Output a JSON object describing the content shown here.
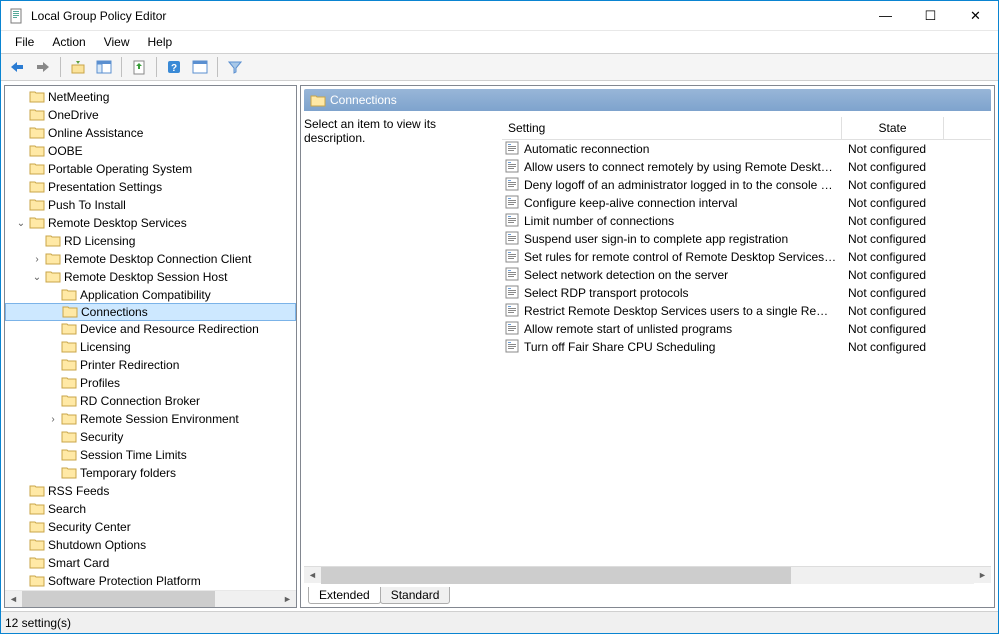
{
  "window": {
    "title": "Local Group Policy Editor",
    "minimize": "—",
    "maximize": "☐",
    "close": "✕"
  },
  "menu": {
    "file": "File",
    "action": "Action",
    "view": "View",
    "help": "Help"
  },
  "tree": [
    {
      "label": "NetMeeting",
      "indent": 3,
      "exp": ""
    },
    {
      "label": "OneDrive",
      "indent": 3,
      "exp": ""
    },
    {
      "label": "Online Assistance",
      "indent": 3,
      "exp": ""
    },
    {
      "label": "OOBE",
      "indent": 3,
      "exp": ""
    },
    {
      "label": "Portable Operating System",
      "indent": 3,
      "exp": ""
    },
    {
      "label": "Presentation Settings",
      "indent": 3,
      "exp": ""
    },
    {
      "label": "Push To Install",
      "indent": 3,
      "exp": ""
    },
    {
      "label": "Remote Desktop Services",
      "indent": 3,
      "exp": "v"
    },
    {
      "label": "RD Licensing",
      "indent": 4,
      "exp": ""
    },
    {
      "label": "Remote Desktop Connection Client",
      "indent": 4,
      "exp": ">"
    },
    {
      "label": "Remote Desktop Session Host",
      "indent": 4,
      "exp": "v"
    },
    {
      "label": "Application Compatibility",
      "indent": 5,
      "exp": ""
    },
    {
      "label": "Connections",
      "indent": 5,
      "exp": "",
      "selected": true
    },
    {
      "label": "Device and Resource Redirection",
      "indent": 5,
      "exp": ""
    },
    {
      "label": "Licensing",
      "indent": 5,
      "exp": ""
    },
    {
      "label": "Printer Redirection",
      "indent": 5,
      "exp": ""
    },
    {
      "label": "Profiles",
      "indent": 5,
      "exp": ""
    },
    {
      "label": "RD Connection Broker",
      "indent": 5,
      "exp": ""
    },
    {
      "label": "Remote Session Environment",
      "indent": 5,
      "exp": ">"
    },
    {
      "label": "Security",
      "indent": 5,
      "exp": ""
    },
    {
      "label": "Session Time Limits",
      "indent": 5,
      "exp": ""
    },
    {
      "label": "Temporary folders",
      "indent": 5,
      "exp": ""
    },
    {
      "label": "RSS Feeds",
      "indent": 3,
      "exp": ""
    },
    {
      "label": "Search",
      "indent": 3,
      "exp": ""
    },
    {
      "label": "Security Center",
      "indent": 3,
      "exp": ""
    },
    {
      "label": "Shutdown Options",
      "indent": 3,
      "exp": ""
    },
    {
      "label": "Smart Card",
      "indent": 3,
      "exp": ""
    },
    {
      "label": "Software Protection Platform",
      "indent": 3,
      "exp": ""
    }
  ],
  "right": {
    "header": "Connections",
    "desc_prompt": "Select an item to view its description.",
    "col_setting": "Setting",
    "col_state": "State",
    "settings": [
      {
        "name": "Automatic reconnection",
        "state": "Not configured"
      },
      {
        "name": "Allow users to connect remotely by using Remote Desktop S...",
        "state": "Not configured"
      },
      {
        "name": "Deny logoff of an administrator logged in to the console ses...",
        "state": "Not configured"
      },
      {
        "name": "Configure keep-alive connection interval",
        "state": "Not configured"
      },
      {
        "name": "Limit number of connections",
        "state": "Not configured"
      },
      {
        "name": "Suspend user sign-in to complete app registration",
        "state": "Not configured"
      },
      {
        "name": "Set rules for remote control of Remote Desktop Services use...",
        "state": "Not configured"
      },
      {
        "name": "Select network detection on the server",
        "state": "Not configured"
      },
      {
        "name": "Select RDP transport protocols",
        "state": "Not configured"
      },
      {
        "name": "Restrict Remote Desktop Services users to a single Remote D...",
        "state": "Not configured"
      },
      {
        "name": "Allow remote start of unlisted programs",
        "state": "Not configured"
      },
      {
        "name": "Turn off Fair Share CPU Scheduling",
        "state": "Not configured"
      }
    ]
  },
  "tabs": {
    "extended": "Extended",
    "standard": "Standard"
  },
  "status": "12 setting(s)"
}
